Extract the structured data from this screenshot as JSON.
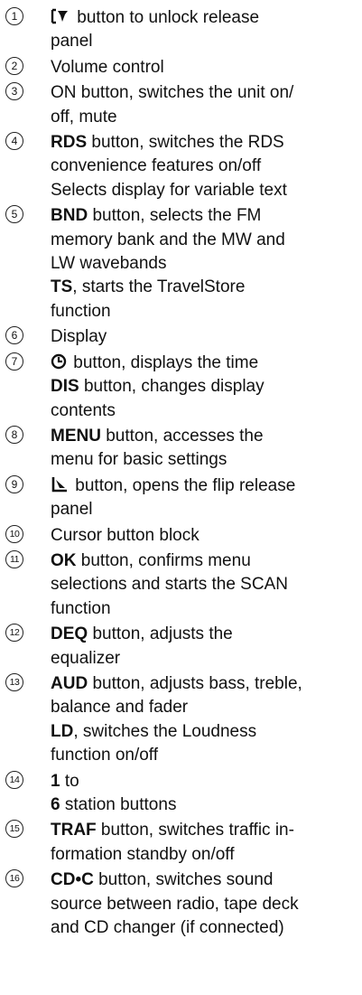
{
  "items": [
    {
      "number": "1",
      "lines": [
        {
          "icon": "unlock-release-panel-icon",
          "text": " button to unlock release"
        },
        {
          "text": "panel"
        }
      ]
    },
    {
      "number": "2",
      "lines": [
        {
          "text": "Volume control"
        }
      ]
    },
    {
      "number": "3",
      "lines": [
        {
          "text": "ON button, switches the unit on/"
        },
        {
          "text": "off, mute"
        }
      ]
    },
    {
      "number": "4",
      "lines": [
        {
          "bold": "RDS",
          "text": " button, switches the RDS"
        },
        {
          "text": "convenience features on/off"
        },
        {
          "text": "Selects display for variable text"
        }
      ]
    },
    {
      "number": "5",
      "lines": [
        {
          "bold": "BND",
          "text": " button, selects the FM"
        },
        {
          "text": "memory bank and the MW and"
        },
        {
          "text": "LW wavebands"
        },
        {
          "bold": "TS",
          "text": ", starts the TravelStore"
        },
        {
          "text": "function"
        }
      ]
    },
    {
      "number": "6",
      "lines": [
        {
          "text": "Display"
        }
      ]
    },
    {
      "number": "7",
      "lines": [
        {
          "icon": "clock-icon",
          "text": " button, displays the time"
        },
        {
          "bold": "DIS",
          "text": " button, changes display"
        },
        {
          "text": "contents"
        }
      ]
    },
    {
      "number": "8",
      "lines": [
        {
          "bold": "MENU",
          "text": " button, accesses the"
        },
        {
          "text": "menu for basic settings"
        }
      ]
    },
    {
      "number": "9",
      "lines": [
        {
          "icon": "flip-release-panel-icon",
          "text": " button, opens the flip release"
        },
        {
          "text": "panel"
        }
      ]
    },
    {
      "number": "10",
      "lines": [
        {
          "text": "Cursor button block"
        }
      ]
    },
    {
      "number": "11",
      "lines": [
        {
          "bold": "OK",
          "text": " button, confirms menu"
        },
        {
          "text": "selections and starts the SCAN"
        },
        {
          "text": "function"
        }
      ]
    },
    {
      "number": "12",
      "lines": [
        {
          "bold": "DEQ",
          "text": " button, adjusts the"
        },
        {
          "text": "equalizer"
        }
      ]
    },
    {
      "number": "13",
      "lines": [
        {
          "bold": "AUD",
          "text": " button, adjusts bass, treble,"
        },
        {
          "text": "balance and fader"
        },
        {
          "bold": "LD",
          "text": ", switches the Loudness"
        },
        {
          "text": "function on/off"
        }
      ]
    },
    {
      "number": "14",
      "lines": [
        {
          "bold": "1",
          "text": " to "
        },
        {
          "bold_tail": "6",
          "text_tail": " station buttons"
        }
      ]
    },
    {
      "number": "15",
      "lines": [
        {
          "bold": "TRAF",
          "text": " button, switches traffic in-"
        },
        {
          "text": "formation standby on/off"
        }
      ]
    },
    {
      "number": "16",
      "lines": [
        {
          "bold": "CD•C",
          "text": " button, switches sound"
        },
        {
          "text": "source between radio, tape deck"
        },
        {
          "text": "and CD changer (if connected)"
        }
      ]
    }
  ]
}
